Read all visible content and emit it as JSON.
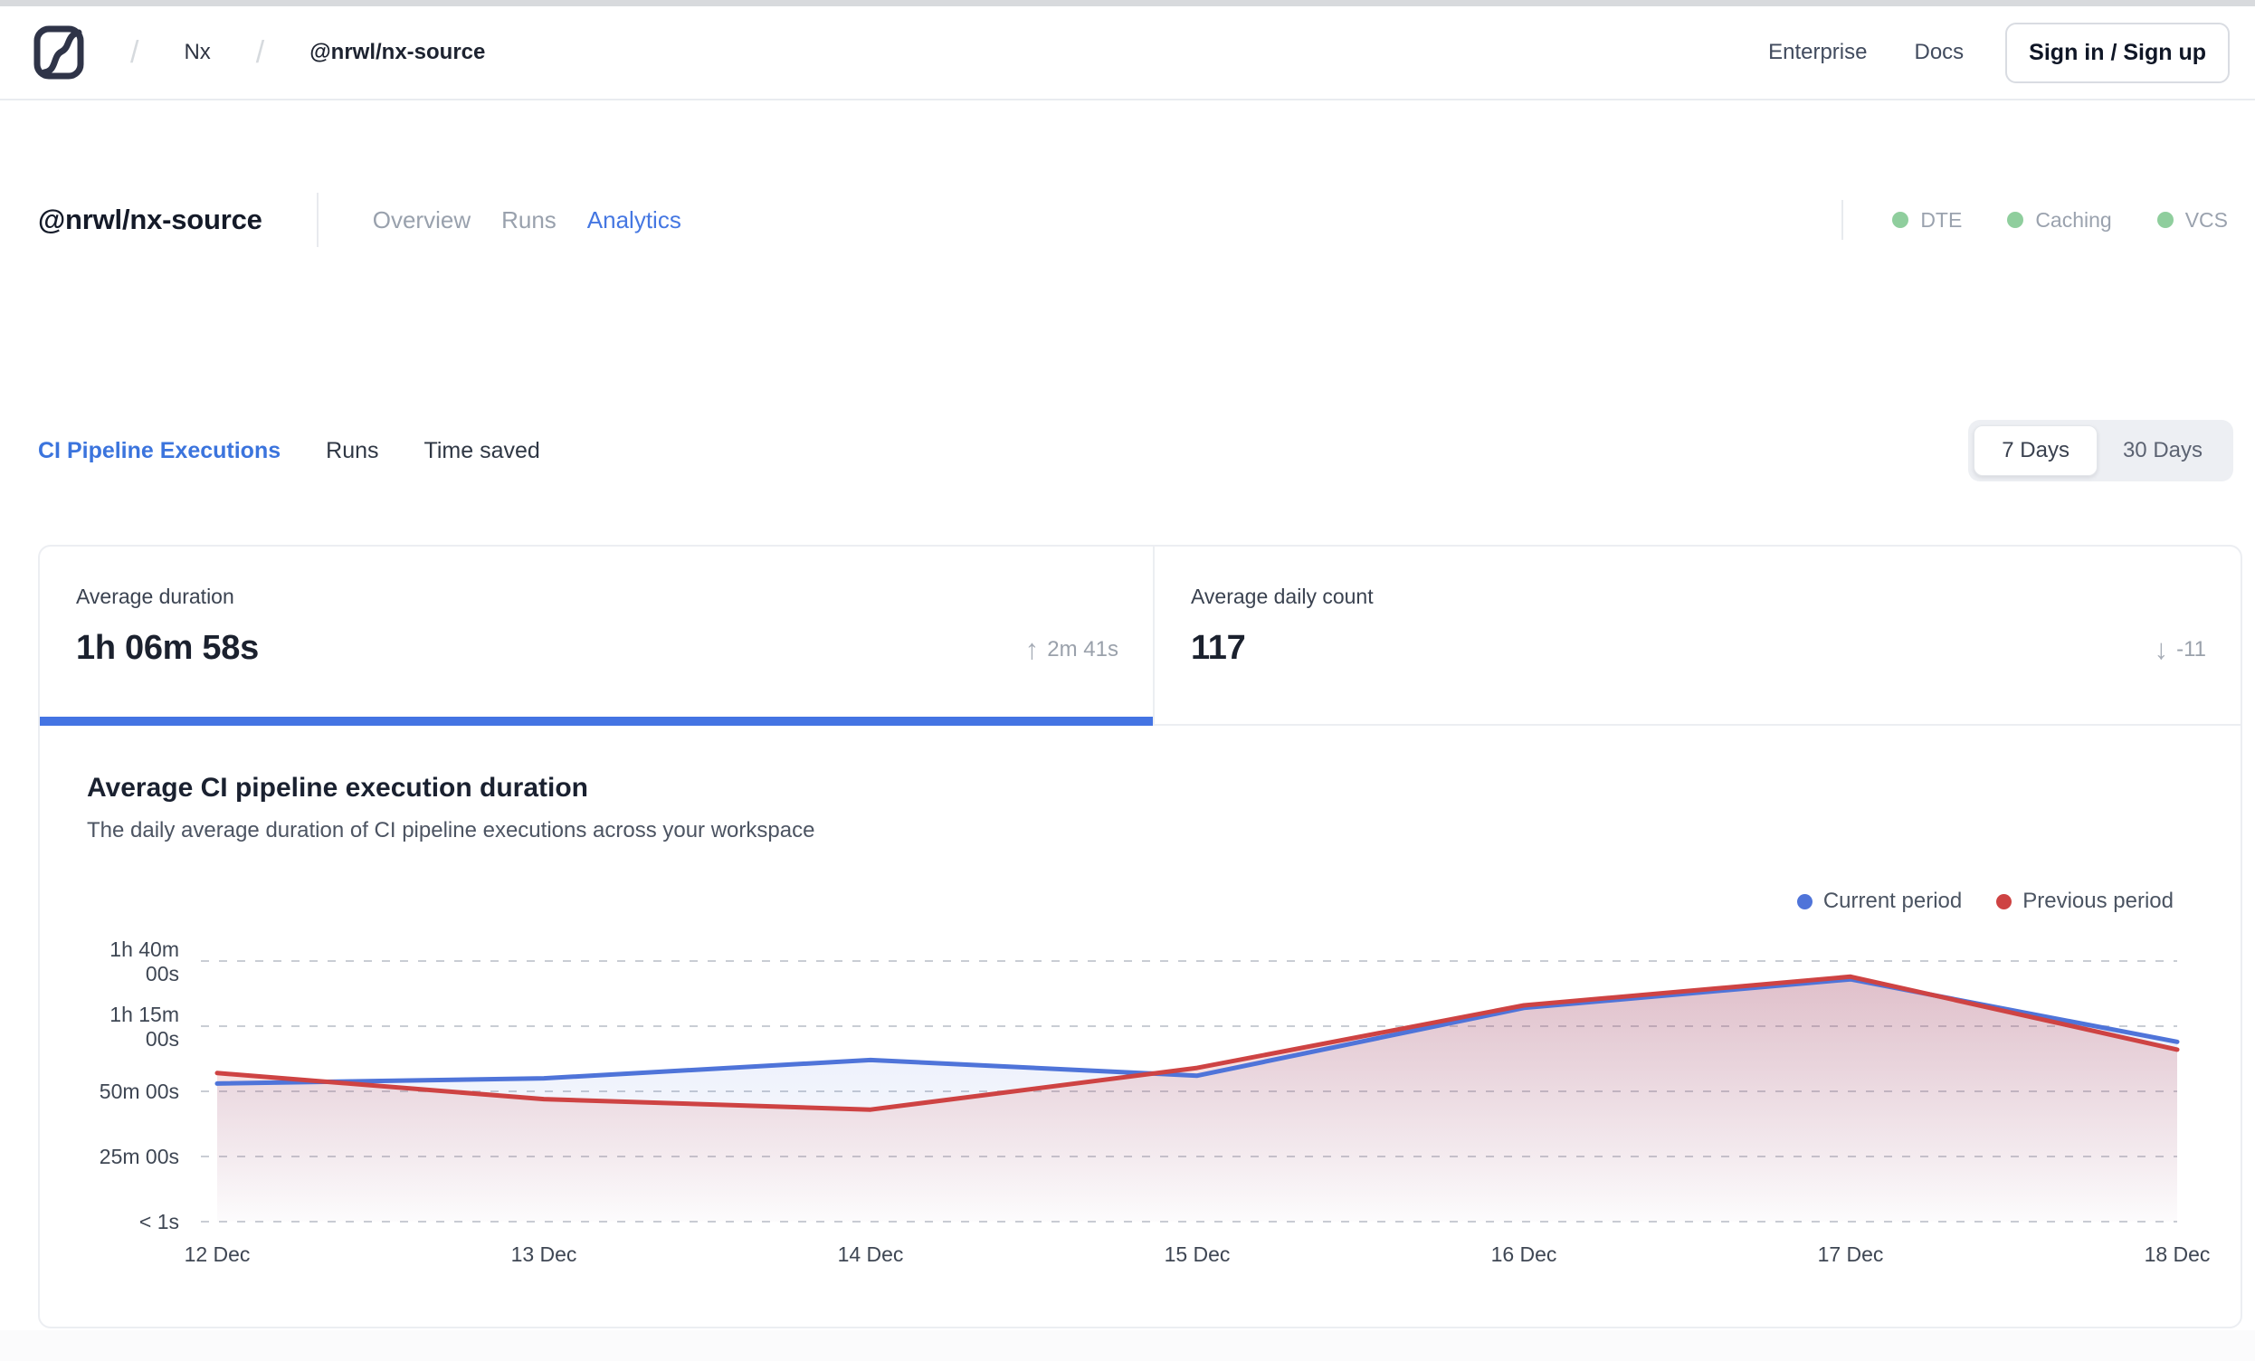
{
  "header": {
    "breadcrumb": {
      "separator": "/",
      "items": [
        "Nx",
        "@nrwl/nx-source"
      ]
    },
    "links": [
      "Enterprise",
      "Docs"
    ],
    "signin_label": "Sign in / Sign up"
  },
  "project": {
    "title": "@nrwl/nx-source",
    "tabs": [
      {
        "label": "Overview",
        "active": false
      },
      {
        "label": "Runs",
        "active": false
      },
      {
        "label": "Analytics",
        "active": true
      }
    ],
    "status": [
      {
        "label": "DTE"
      },
      {
        "label": "Caching"
      },
      {
        "label": "VCS"
      }
    ]
  },
  "sections": {
    "tabs": [
      "CI Pipeline Executions",
      "Runs",
      "Time saved"
    ],
    "period_toggle": {
      "options": [
        "7 Days",
        "30 Days"
      ],
      "selected": "7 Days"
    }
  },
  "stats": {
    "cards": [
      {
        "label": "Average duration",
        "value": "1h 06m 58s",
        "delta": "2m 41s",
        "direction": "up",
        "icon": "↑",
        "active": true
      },
      {
        "label": "Average daily count",
        "value": "117",
        "delta": "-11",
        "direction": "down",
        "icon": "↓",
        "active": false
      }
    ]
  },
  "colors": {
    "accent_blue": "#4474e3",
    "link_blue": "#4577e2",
    "chart_blue": "#4f74d9",
    "chart_red": "#ce4343",
    "status_green": "#8fce9d",
    "grid_gray": "#c9cdd4"
  },
  "chart_data": {
    "type": "area",
    "title": "Average CI pipeline execution duration",
    "subtitle": "The daily average duration of CI pipeline executions across your workspace",
    "x": [
      "12 Dec",
      "13 Dec",
      "14 Dec",
      "15 Dec",
      "16 Dec",
      "17 Dec",
      "18 Dec"
    ],
    "y_axis": {
      "unit": "minutes",
      "range": [
        0,
        108
      ],
      "ticks": [
        {
          "value": 100,
          "label": [
            "1h 40m",
            "00s"
          ]
        },
        {
          "value": 75,
          "label": [
            "1h 15m",
            "00s"
          ]
        },
        {
          "value": 50,
          "label": [
            "50m 00s"
          ]
        },
        {
          "value": 25,
          "label": [
            "25m 00s"
          ]
        },
        {
          "value": 0,
          "label": [
            "< 1s"
          ]
        }
      ]
    },
    "series": [
      {
        "name": "Current period",
        "color": "#4f74d9",
        "fill_opacity_top": 0.14,
        "values_minutes": [
          53,
          55,
          62,
          56,
          82,
          93,
          69
        ]
      },
      {
        "name": "Previous period",
        "color": "#ce4343",
        "fill_opacity_top": 0.26,
        "values_minutes": [
          57,
          47,
          43,
          59,
          83,
          94,
          66
        ]
      }
    ],
    "grid": "dashed-horizontal",
    "legend_position": "top-right"
  }
}
